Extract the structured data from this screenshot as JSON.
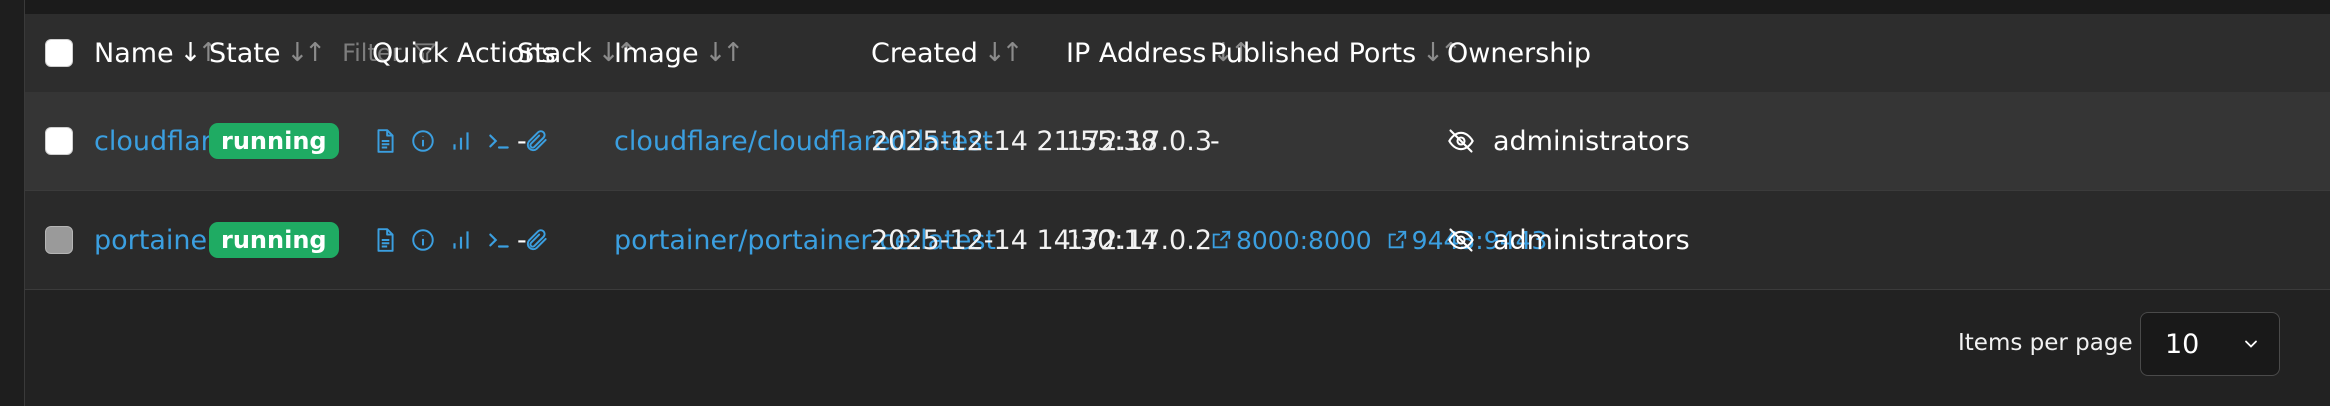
{
  "table": {
    "columns": {
      "name": "Name",
      "state": "State",
      "state_filter": "Filter",
      "quick_actions": "Quick Actions",
      "stack": "Stack",
      "image": "Image",
      "created": "Created",
      "ip": "IP Address",
      "ports": "Published Ports",
      "ownership": "Ownership"
    },
    "sort_arrows": {
      "down": "↓",
      "up": "↑"
    },
    "rows": [
      {
        "name": "cloudflared",
        "state": "running",
        "stack": "-",
        "image": "cloudflare/cloudflared:latest",
        "created": "2025-12-14 21:55:38",
        "ip": "172.17.0.3",
        "ports": [],
        "ports_empty": "-",
        "ownership": "administrators",
        "quick_actions": [
          "logs-icon",
          "inspect-icon",
          "stats-icon",
          "console-icon",
          "attach-icon"
        ]
      },
      {
        "name": "portainer",
        "state": "running",
        "stack": "-",
        "image": "portainer/portainer-ce:latest",
        "created": "2025-12-14 14:30:14",
        "ip": "172.17.0.2",
        "ports": [
          "8000:8000",
          "9443:9443"
        ],
        "ownership": "administrators",
        "quick_actions": [
          "logs-icon",
          "inspect-icon",
          "stats-icon",
          "console-icon",
          "attach-icon"
        ]
      }
    ]
  },
  "pagination": {
    "items_per_page_label": "Items per page",
    "items_per_page_value": "10"
  },
  "colors": {
    "link": "#3b9fe0",
    "running_badge": "#1fab63",
    "header_bg": "#2d2d2d"
  }
}
